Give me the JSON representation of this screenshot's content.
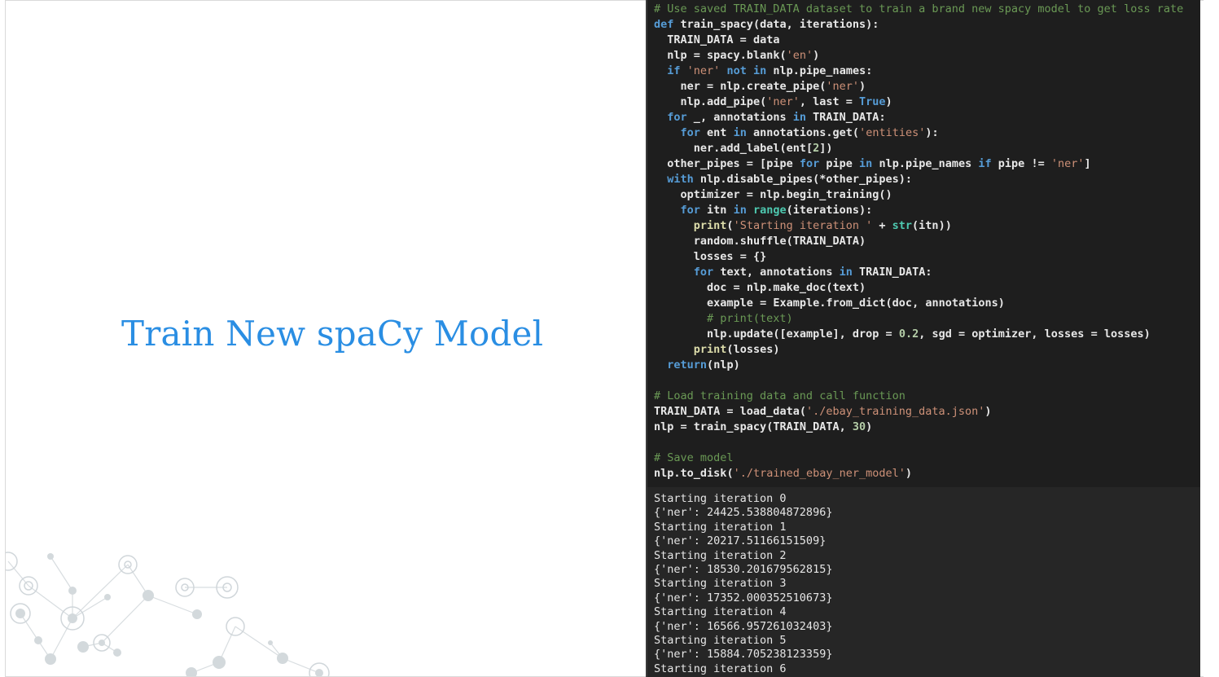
{
  "slide": {
    "title": "Train New spaCy Model"
  },
  "colors": {
    "title": "#2a8ee3",
    "code_bg": "#1e1e1e",
    "output_bg": "#262626",
    "comment": "#6a9955",
    "keyword": "#569cd6",
    "string": "#ce9178",
    "number": "#b5cea8",
    "builtin": "#4ec9b0",
    "function": "#dcdcaa"
  },
  "code_lines": [
    "# Use saved TRAIN_DATA dataset to train a brand new spacy model to get loss rate",
    "def train_spacy(data, iterations):",
    "  TRAIN_DATA = data",
    "  nlp = spacy.blank('en')",
    "  if 'ner' not in nlp.pipe_names:",
    "    ner = nlp.create_pipe('ner')",
    "    nlp.add_pipe('ner', last = True)",
    "  for _, annotations in TRAIN_DATA:",
    "    for ent in annotations.get('entities'):",
    "      ner.add_label(ent[2])",
    "  other_pipes = [pipe for pipe in nlp.pipe_names if pipe != 'ner']",
    "  with nlp.disable_pipes(*other_pipes):",
    "    optimizer = nlp.begin_training()",
    "    for itn in range(iterations):",
    "      print('Starting iteration ' + str(itn))",
    "      random.shuffle(TRAIN_DATA)",
    "      losses = {}",
    "      for text, annotations in TRAIN_DATA:",
    "        doc = nlp.make_doc(text)",
    "        example = Example.from_dict(doc, annotations)",
    "        # print(text)",
    "        nlp.update([example], drop = 0.2, sgd = optimizer, losses = losses)",
    "      print(losses)",
    "  return(nlp)",
    "",
    "# Load training data and call function",
    "TRAIN_DATA = load_data('./ebay_training_data.json')",
    "nlp = train_spacy(TRAIN_DATA, 30)",
    "",
    "# Save model",
    "nlp.to_disk('./trained_ebay_ner_model')"
  ],
  "output_lines": [
    "Starting iteration 0",
    "{'ner': 24425.538804872896}",
    "Starting iteration 1",
    "{'ner': 20217.51166151509}",
    "Starting iteration 2",
    "{'ner': 18530.201679562815}",
    "Starting iteration 3",
    "{'ner': 17352.000352510673}",
    "Starting iteration 4",
    "{'ner': 16566.957261032403}",
    "Starting iteration 5",
    "{'ner': 15884.705238123359}",
    "Starting iteration 6"
  ]
}
